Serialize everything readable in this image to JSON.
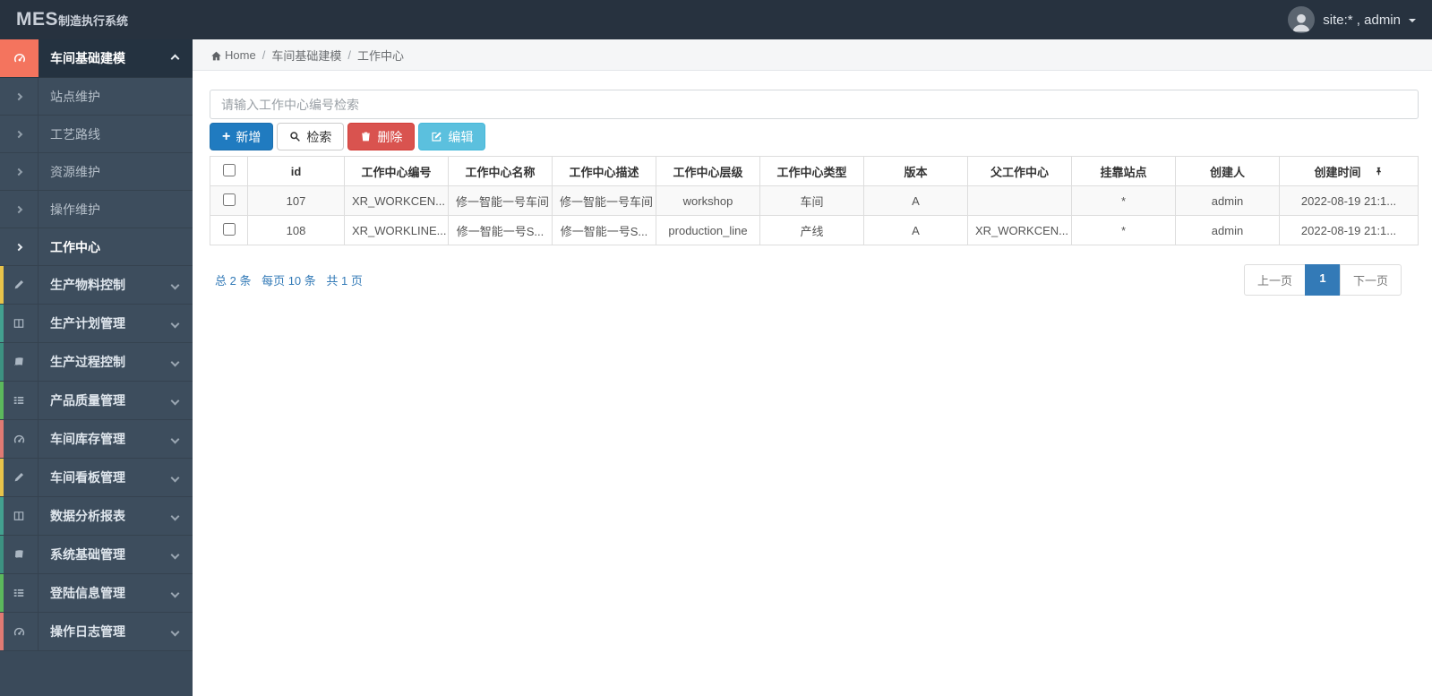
{
  "navbar": {
    "logo_bold": "MES",
    "logo_rest": "制造执行系统",
    "user_label": "site:* , admin"
  },
  "breadcrumb": {
    "home": "Home",
    "level1": "车间基础建模",
    "level2": "工作中心",
    "sep": "/"
  },
  "sidebar": {
    "active_group": {
      "label": "车间基础建模",
      "icon": "gauge-icon",
      "icon_bg": "#f4745e"
    },
    "sub_items": [
      {
        "label": "站点维护"
      },
      {
        "label": "工艺路线"
      },
      {
        "label": "资源维护"
      },
      {
        "label": "操作维护"
      },
      {
        "label": "工作中心",
        "active": true
      }
    ],
    "groups": [
      {
        "label": "生产物料控制",
        "icon": "pencil-icon",
        "strip": "#e8c34a"
      },
      {
        "label": "生产计划管理",
        "icon": "columns-icon",
        "strip": "#43a08f"
      },
      {
        "label": "生产过程控制",
        "icon": "book-icon",
        "strip": "#3d9181"
      },
      {
        "label": "产品质量管理",
        "icon": "list-icon",
        "strip": "#5cb85c"
      },
      {
        "label": "车间库存管理",
        "icon": "gauge-icon",
        "strip": "#e07a73"
      },
      {
        "label": "车间看板管理",
        "icon": "pencil-icon",
        "strip": "#e8c34a"
      },
      {
        "label": "数据分析报表",
        "icon": "columns-icon",
        "strip": "#43a08f"
      },
      {
        "label": "系统基础管理",
        "icon": "book-icon",
        "strip": "#3d9181"
      },
      {
        "label": "登陆信息管理",
        "icon": "list-icon",
        "strip": "#5cb85c"
      },
      {
        "label": "操作日志管理",
        "icon": "gauge-icon",
        "strip": "#e07a73"
      }
    ]
  },
  "toolbar": {
    "search_placeholder": "请输入工作中心编号检索",
    "add_label": "新增",
    "search_label": "检索",
    "delete_label": "删除",
    "edit_label": "编辑"
  },
  "table": {
    "columns": [
      "id",
      "工作中心编号",
      "工作中心名称",
      "工作中心描述",
      "工作中心层级",
      "工作中心类型",
      "版本",
      "父工作中心",
      "挂靠站点",
      "创建人",
      "创建时间"
    ],
    "rows": [
      [
        "107",
        "XR_WORKCEN...",
        "修一智能一号车间",
        "修一智能一号车间",
        "workshop",
        "车间",
        "A",
        "",
        "*",
        "admin",
        "2022-08-19 21:1..."
      ],
      [
        "108",
        "XR_WORKLINE...",
        "修一智能一号S...",
        "修一智能一号S...",
        "production_line",
        "产线",
        "A",
        "XR_WORKCEN...",
        "*",
        "admin",
        "2022-08-19 21:1..."
      ]
    ]
  },
  "pagination": {
    "total": "总 2 条",
    "per_page": "每页 10 条",
    "pages": "共 1 页",
    "prev": "上一页",
    "current": "1",
    "next": "下一页"
  },
  "colors": {
    "topbar_bg": "#27323f",
    "sidebar_bg": "#3d4d5d",
    "active_icon_bg": "#f4745e",
    "primary_blue": "#207bc0",
    "danger_red": "#d9534f",
    "info_cyan": "#5bc0de",
    "active_page_blue": "#337ab7",
    "link_blue": "#337ab7"
  }
}
